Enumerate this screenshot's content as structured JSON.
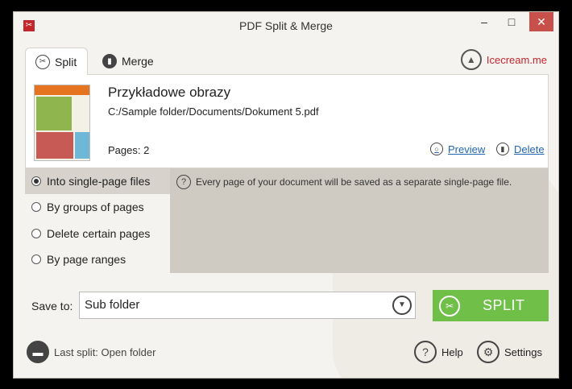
{
  "window": {
    "title": "PDF Split & Merge",
    "app_icon": "split-merge-app-icon",
    "controls": {
      "minimize": "–",
      "maximize": "□",
      "close": "✕"
    }
  },
  "tabs": [
    {
      "label": "Split",
      "icon": "split-icon",
      "selected": true
    },
    {
      "label": "Merge",
      "icon": "merge-icon",
      "selected": false
    }
  ],
  "brand": {
    "label": "Icecream.me",
    "icon": "icecream-logo-icon"
  },
  "document": {
    "title": "Przykładowe obrazy",
    "path": "C:/Sample folder/Documents/Dokument 5.pdf",
    "pages": "Pages: 2",
    "preview_label": "Preview",
    "delete_label": "Delete"
  },
  "options": {
    "items": [
      {
        "label": "Into single-page files",
        "selected": true
      },
      {
        "label": "By groups of pages",
        "selected": false
      },
      {
        "label": "Delete certain pages",
        "selected": false
      },
      {
        "label": "By page ranges",
        "selected": false
      }
    ],
    "info": "Every page of your document will be saved as a separate single-page file."
  },
  "save": {
    "label": "Save to:",
    "value": "Sub folder"
  },
  "split_button": {
    "label": "SPLIT"
  },
  "footer": {
    "last_split": "Last split: Open folder",
    "help": "Help",
    "settings": "Settings"
  },
  "colors": {
    "accent_green": "#6fbf49",
    "brand_red": "#c1272d",
    "link_blue": "#1f67b0"
  }
}
